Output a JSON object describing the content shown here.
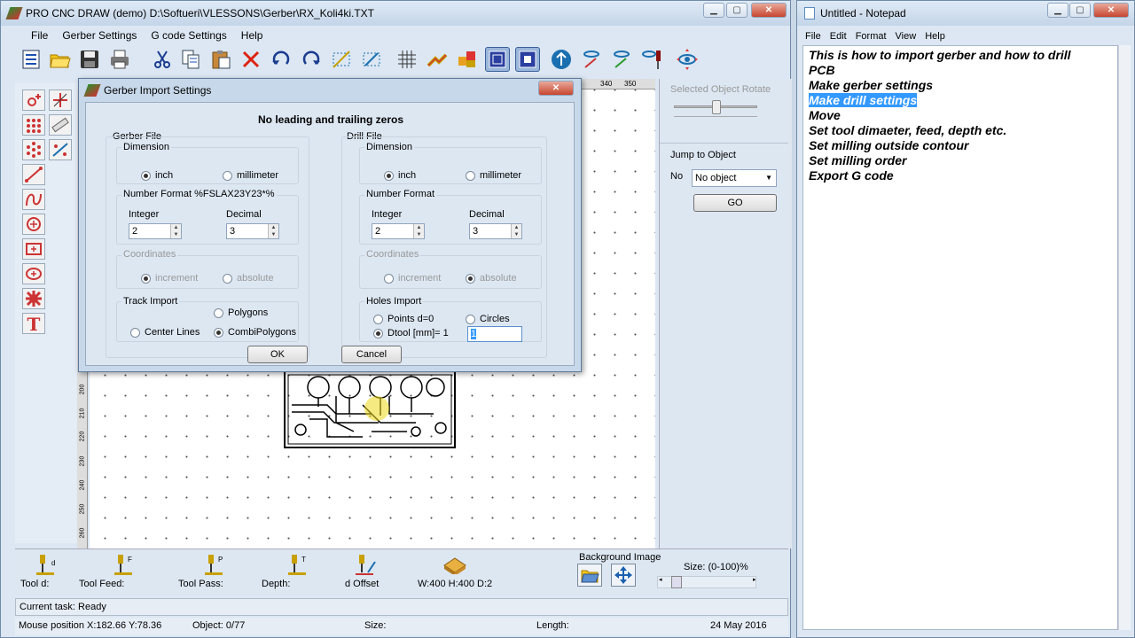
{
  "app": {
    "title": "PRO CNC DRAW (demo) D:\\Softueri\\VLESSONS\\Gerber\\RX_Koli4ki.TXT",
    "menu": [
      "File",
      "Gerber Settings",
      "G code Settings",
      "Help"
    ]
  },
  "toolbar_icons": [
    "list-icon",
    "open-folder-icon",
    "save-icon",
    "print-icon",
    "cut-icon",
    "copy-icon",
    "paste-icon",
    "delete-icon",
    "undo-icon",
    "redo-icon",
    "select-area-icon",
    "zoom-area-icon",
    "grid-icon",
    "connect-icon",
    "blocks-icon",
    "square-view-icon",
    "square-view-2-icon",
    "mirror-icon",
    "tool-path-icon",
    "tool-path-2-icon",
    "drill-bit-icon",
    "eye-target-icon"
  ],
  "side_icons": [
    "add-point-icon",
    "crosshair-icon",
    "dots-icon",
    "ruler-icon",
    "dots-circle-icon",
    "drill-settings-icon",
    "line-tool-icon",
    "curve-tool-icon",
    "circle-tool-icon",
    "rect-tool-icon",
    "ellipse-tool-icon",
    "gear-tool-icon",
    "text-tool-icon"
  ],
  "ruler": {
    "top_ticks": [
      "340",
      "350"
    ],
    "left_ticks": [
      "200",
      "210",
      "220",
      "230",
      "240",
      "250",
      "260"
    ]
  },
  "dialog": {
    "title": "Gerber Import Settings",
    "heading": "No leading and trailing zeros",
    "gerber": {
      "group_label": "Gerber File",
      "dimension_label": "Dimension",
      "unit_inch": "inch",
      "unit_mm": "millimeter",
      "number_format_label": "Number Format  %FSLAX23Y23*%",
      "integer_label": "Integer",
      "integer_value": "2",
      "decimal_label": "Decimal",
      "decimal_value": "3",
      "coordinates_label": "Coordinates",
      "coord_increment": "increment",
      "coord_absolute": "absolute",
      "track_label": "Track Import",
      "polygons": "Polygons",
      "center_lines": "Center Lines",
      "combi_polygons": "CombiPolygons"
    },
    "drill": {
      "group_label": "Drill File",
      "dimension_label": "Dimension",
      "unit_inch": "inch",
      "unit_mm": "millimeter",
      "number_format_label": "Number Format",
      "integer_label": "Integer",
      "integer_value": "2",
      "decimal_label": "Decimal",
      "decimal_value": "3",
      "coordinates_label": "Coordinates",
      "coord_increment": "increment",
      "coord_absolute": "absolute",
      "holes_label": "Holes Import",
      "points": "Points d=0",
      "circles": "Circles",
      "dtool": "Dtool [mm]= 1",
      "dtool_value": "1"
    },
    "ok": "OK",
    "cancel": "Cancel"
  },
  "right_panel": {
    "rotate_label": "Selected Object Rotate",
    "jump_label": "Jump to Object",
    "no_label": "No",
    "select_value": "No object",
    "go_button": "GO"
  },
  "bottom": {
    "tool_d": "Tool d:",
    "tool_feed": "Tool Feed:",
    "tool_pass": "Tool Pass:",
    "depth": "Depth:",
    "d_offset": "d Offset",
    "size_info": "W:400 H:400 D:2",
    "background_image": "Background Image",
    "size_pct": "Size: (0-100)%"
  },
  "status": {
    "current_task": "Current task: Ready",
    "mouse_position": "Mouse position X:182.66 Y:78.36",
    "object": "Object: 0/77",
    "size": "Size:",
    "length": "Length:",
    "date": "24 May 2016"
  },
  "notepad": {
    "title": "Untitled - Notepad",
    "menu": [
      "File",
      "Edit",
      "Format",
      "View",
      "Help"
    ],
    "lines": [
      "This is how to import gerber and how to drill",
      "PCB",
      "Make gerber settings",
      "Make drill settings",
      "Move",
      "Set tool dimaeter, feed, depth etc.",
      "Set milling outside contour",
      "Set milling order",
      "Export G code"
    ],
    "selected_line": 3
  }
}
